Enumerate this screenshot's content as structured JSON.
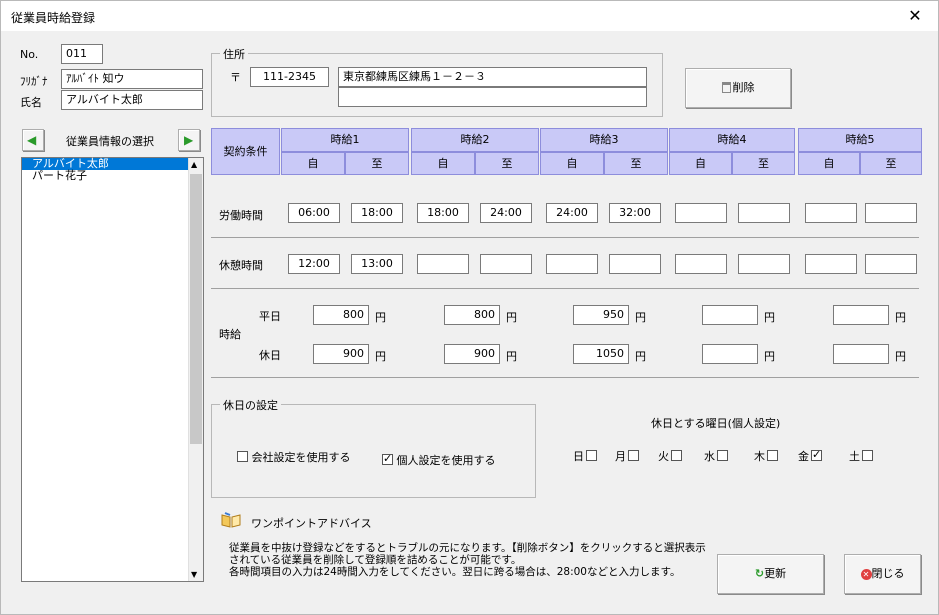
{
  "window": {
    "title": "従業員時給登録",
    "close": "✕"
  },
  "employee": {
    "no_label": "No.",
    "no_value": "011",
    "kana_label": "ﾌﾘｶﾞﾅ",
    "kana_value": "ｱﾙﾊﾞｲﾄ 知ウ",
    "name_label": "氏名",
    "name_value": "アルバイト太郎"
  },
  "address": {
    "group_title": "住所",
    "postal_mark": "〒",
    "postal_value": "111-2345",
    "line1": "東京都練馬区練馬１－２－３",
    "line2": ""
  },
  "delete_button": {
    "label": "削除",
    "icon": "trash-icon"
  },
  "employee_list": {
    "title": "従業員情報の選択",
    "items": [
      "アルバイト太郎",
      "パート花子"
    ],
    "selected": 0
  },
  "table": {
    "contract_label": "契約条件",
    "wage_headers": [
      "時給1",
      "時給2",
      "時給3",
      "時給4",
      "時給5"
    ],
    "from_label": "自",
    "to_label": "至",
    "work_label": "労働時間",
    "work_times": [
      [
        "06:00",
        "18:00"
      ],
      [
        "18:00",
        "24:00"
      ],
      [
        "24:00",
        "32:00"
      ],
      [
        "",
        ""
      ],
      [
        "",
        ""
      ]
    ],
    "break_label": "休憩時間",
    "break_times": [
      [
        "12:00",
        "13:00"
      ],
      [
        "",
        ""
      ],
      [
        "",
        ""
      ],
      [
        "",
        ""
      ],
      [
        "",
        ""
      ]
    ],
    "wage_label": "時給",
    "weekday_label": "平日",
    "holiday_label": "休日",
    "yen": "円",
    "weekday_wages": [
      "800",
      "800",
      "950",
      "",
      ""
    ],
    "holiday_wages": [
      "900",
      "900",
      "1050",
      "",
      ""
    ]
  },
  "holiday_setting": {
    "group_title": "休日の設定",
    "company_label": "会社設定を使用する",
    "company_checked": false,
    "personal_label": "個人設定を使用する",
    "personal_checked": true,
    "weekday_title": "休日とする曜日(個人設定)",
    "days": [
      {
        "label": "日",
        "checked": false
      },
      {
        "label": "月",
        "checked": false
      },
      {
        "label": "火",
        "checked": false
      },
      {
        "label": "水",
        "checked": false
      },
      {
        "label": "木",
        "checked": false
      },
      {
        "label": "金",
        "checked": true
      },
      {
        "label": "土",
        "checked": false
      }
    ]
  },
  "advice": {
    "title": "ワンポイントアドバイス",
    "lines": [
      "従業員を中抜け登録などをするとトラブルの元になります。【削除ボタン】をクリックすると選択表示",
      "されている従業員を削除して登録順を詰めることが可能です。",
      "各時間項目の入力は24時間入力をしてください。翌日に跨る場合は、28:00などと入力します。"
    ]
  },
  "buttons": {
    "update": "更新",
    "close": "閉じる"
  },
  "colors": {
    "header_bg": "#c9c9f7",
    "selection": "#0078d7"
  }
}
